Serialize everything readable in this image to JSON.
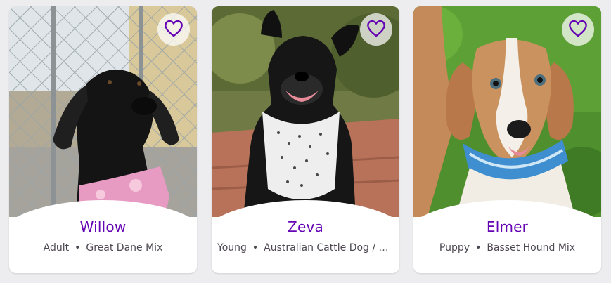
{
  "colors": {
    "accent": "#6504b5",
    "card_bg": "#ffffff",
    "page_bg": "#ededf0",
    "meta_text": "#4d4751"
  },
  "separator": "•",
  "pets": [
    {
      "name": "Willow",
      "age": "Adult",
      "breed": "Great Dane Mix",
      "favorite_icon": "heart-outline-icon"
    },
    {
      "name": "Zeva",
      "age": "Young",
      "breed": "Australian Cattle Dog / B...",
      "favorite_icon": "heart-outline-icon"
    },
    {
      "name": "Elmer",
      "age": "Puppy",
      "breed": "Basset Hound Mix",
      "favorite_icon": "heart-outline-icon"
    }
  ]
}
